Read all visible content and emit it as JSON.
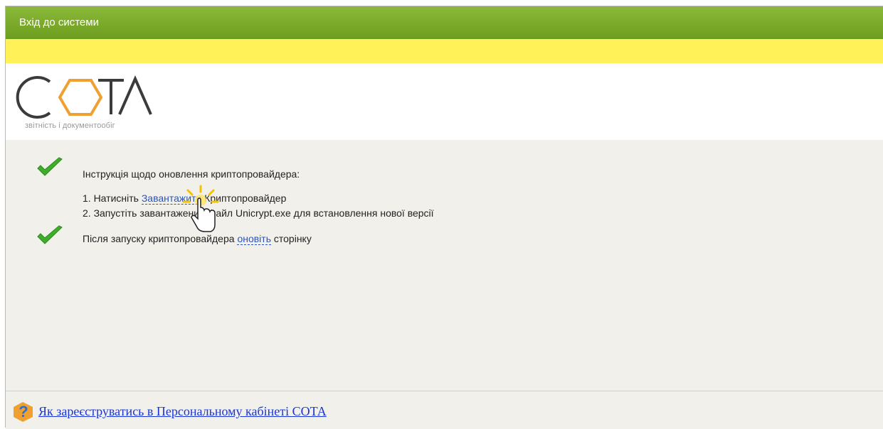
{
  "window": {
    "title": "Вхід до системи"
  },
  "logo": {
    "text": "СОТА",
    "tagline": "звітність і документообіг"
  },
  "instructions": {
    "heading": "Інструкція щодо оновлення криптопровайдера:",
    "step1_prefix": "1. Натисніть ",
    "step1_link": "Завантажити",
    "step1_suffix": " Криптопровайдер",
    "step2": "2. Запустіть завантажений файл Unicrypt.exe для встановлення нової версії",
    "after_prefix": "Після запуску криптопровайдера ",
    "after_link": "оновіть",
    "after_suffix": " сторінку"
  },
  "footer": {
    "help_link": "Як зареєструватись в Персональному кабінеті СОТА"
  },
  "colors": {
    "titlebar": "#7aaa2a",
    "yellowbar": "#fff157",
    "link": "#2b55b9",
    "check": "#3fae2a",
    "help_icon": "#f0a030"
  },
  "icons": [
    "check-icon",
    "cursor-hand-icon",
    "help-question-icon"
  ]
}
